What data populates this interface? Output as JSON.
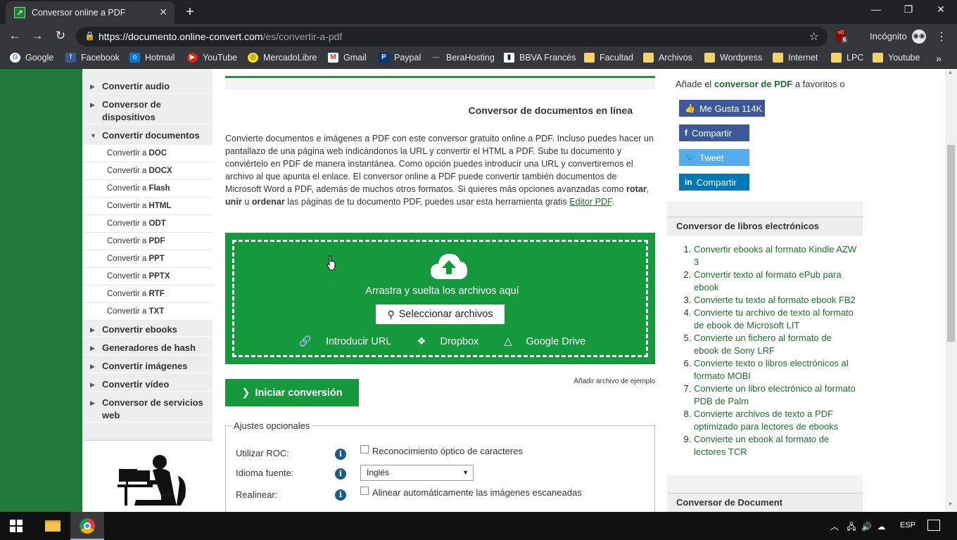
{
  "browser": {
    "tab_title": "Conversor online a PDF",
    "url_domain": "https://documento.online-convert.com",
    "url_path": "/es/convertir-a-pdf",
    "incognito_label": "Incógnito",
    "extension_badge": "6",
    "bookmarks": [
      "Google",
      "Facebook",
      "Hotmail",
      "YouTube",
      "MercadoLibre",
      "Gmail",
      "Paypal",
      "BeraHosting",
      "BBVA Francés",
      "Facultad",
      "Archivos",
      "Wordpress",
      "Internet",
      "LPC",
      "Youtube"
    ]
  },
  "sidebar": {
    "main_items": [
      "Convertir audio",
      "Conversor de dispositivos",
      "Convertir documentos",
      "Convertir ebooks",
      "Generadores de hash",
      "Convertir imágenes",
      "Convertir vídeo",
      "Conversor de servicios web"
    ],
    "sub_prefix": "Convertir a",
    "sub_items": [
      "DOC",
      "DOCX",
      "Flash",
      "HTML",
      "ODT",
      "PDF",
      "PPT",
      "PPTX",
      "RTF",
      "TXT"
    ]
  },
  "main": {
    "heading": "Conversor de documentos en línea",
    "desc_part1": "Convierte documentos e imágenes a PDF con este conversor gratuito online a PDF. Incluso puedes hacer un pantallazo de una página web indicándonos la URL y convertir el HTML a PDF. Sube tu documento y conviértelo en PDF de manera instantánea. Como opción puedes introducir una URL y convertiremos el archivo al que apunta el enlace. El conversor online a PDF puede convertir también documentos de Microsoft Word a PDF, además de muchos otros formatos. Si quieres más opciones avanzadas como ",
    "desc_bold1": "rotar",
    "desc_sep1": ", ",
    "desc_bold2": "unir",
    "desc_sep2": " u ",
    "desc_bold3": "ordenar",
    "desc_part2": " las páginas de tu documento PDF, puedes usar esta herramienta gratis ",
    "desc_link": "Editor PDF",
    "desc_end": ".",
    "drop_text": "Arrastra y suelta los archivos aquí",
    "select_button": "Seleccionar archivos",
    "source_url": "Introducir URL",
    "source_dropbox": "Dropbox",
    "source_gdrive": "Google Drive",
    "start_button": "Iniciar conversión",
    "example_link": "Añadir archivo de ejemplo",
    "options_legend": "Ajustes opcionales",
    "opt_ocr_label": "Utilizar ROC:",
    "opt_ocr_check": "Reconocimiento óptico de caracteres",
    "opt_lang_label": "Idioma fuente:",
    "opt_lang_value": "Inglés",
    "opt_realign_label": "Realinear:",
    "opt_realign_check": "Alinear automáticamente las imágenes escaneadas",
    "info_glyph": "i"
  },
  "right": {
    "fav_pre": "Añade el ",
    "fav_bold": "conversor de PDF",
    "fav_post": " a favoritos o",
    "like": "Me Gusta 114K",
    "fb_share": "Compartir",
    "tweet": "Tweet",
    "li_share": "Compartir",
    "ebooks_title": "Conversor de libros electrónicos",
    "ebooks": [
      "Convertir ebooks al formato Kindle AZW 3",
      "Convertir texto al formato ePub para ebook",
      "Convierte tu texto al formato ebook FB2",
      "Convierte tu archivo de texto al formato de ebook de Microsoft LIT",
      "Convierte un fichero al formato de ebook de Sony LRF",
      "Convierte texto o libros electrónicos al formato MOBI",
      "Convierte un libro electrónico al formato PDB de Palm",
      "Convierte archivos de texto a PDF optimizado para lectores de ebooks",
      "Convierte un ebook al formato de lectores TCR"
    ],
    "doc_title": "Conversor de Document"
  },
  "taskbar": {
    "language": "ESP"
  },
  "colors": {
    "brand_green": "#149a3c",
    "link_green": "#1d6e2d",
    "facebook": "#3b5998",
    "twitter": "#55acee",
    "linkedin": "#0077b5"
  }
}
